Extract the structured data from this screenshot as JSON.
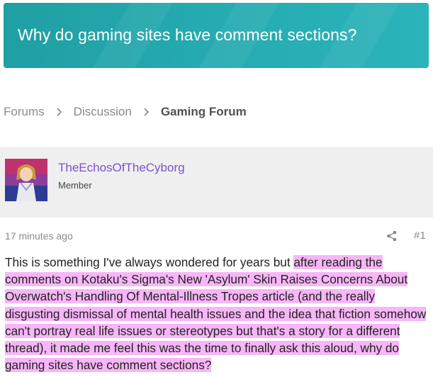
{
  "thread": {
    "title": "Why do gaming sites have comment sections?"
  },
  "breadcrumb": {
    "items": [
      "Forums",
      "Discussion",
      "Gaming Forum"
    ]
  },
  "post": {
    "author": "TheEchosOfTheCyborg",
    "author_title": "Member",
    "timestamp": "17 minutes ago",
    "post_number": "#1",
    "body_plain": "This is something I've always wondered for years but ",
    "body_highlighted": "after reading the comments on Kotaku's Sigma's New 'Asylum' Skin Raises Concerns About Overwatch's Handling Of Mental-Illness Tropes article (and the really disgusting dismissal of mental health issues and the idea that fiction somehow can't portray real life issues or stereotypes but that's a story for a different thread), it made me feel this was the time to finally ask this aloud, why do gaming sites have comment sections?"
  },
  "icons": {
    "breadcrumb_separator": "chevron-right-icon",
    "share": "share-icon"
  },
  "colors": {
    "banner": "#25aab0",
    "username": "#7a52c9",
    "highlight": "#f7b6f7",
    "userbar_bg": "#efefef"
  }
}
